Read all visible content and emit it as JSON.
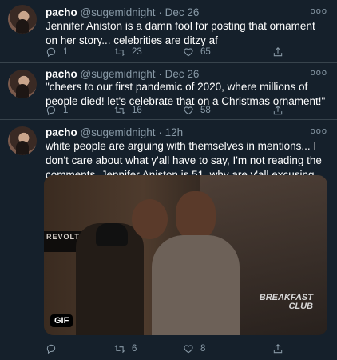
{
  "tweets": [
    {
      "name": "pacho",
      "handle": "@sugemidnight",
      "separator": "·",
      "time": "Dec 26",
      "more": "ooo",
      "text": "Jennifer Aniston is a damn fool for posting that ornament on her story... celebrities are ditzy af",
      "replies": "1",
      "retweets": "23",
      "likes": "65"
    },
    {
      "name": "pacho",
      "handle": "@sugemidnight",
      "separator": "·",
      "time": "Dec 26",
      "more": "ooo",
      "text": "\"cheers to our first pandemic of 2020, where millions of people died! let's celebrate that on a Christmas ornament!\"",
      "replies": "1",
      "retweets": "16",
      "likes": "58"
    },
    {
      "name": "pacho",
      "handle": "@sugemidnight",
      "separator": "·",
      "time": "12h",
      "more": "ooo",
      "text": "white people are arguing with themselves in mentions... I don't care about what y'all have to say, I'm not reading the comments. Jennifer Aniston is 51, why are y'all excusing \"sarcastic\" behavior?",
      "replies": "",
      "retweets": "6",
      "likes": "8",
      "media": {
        "badge": "GIF",
        "sign_text": "REVOLT",
        "watermark_line1": "BREAKFAST",
        "watermark_line2": "CLUB"
      }
    }
  ]
}
